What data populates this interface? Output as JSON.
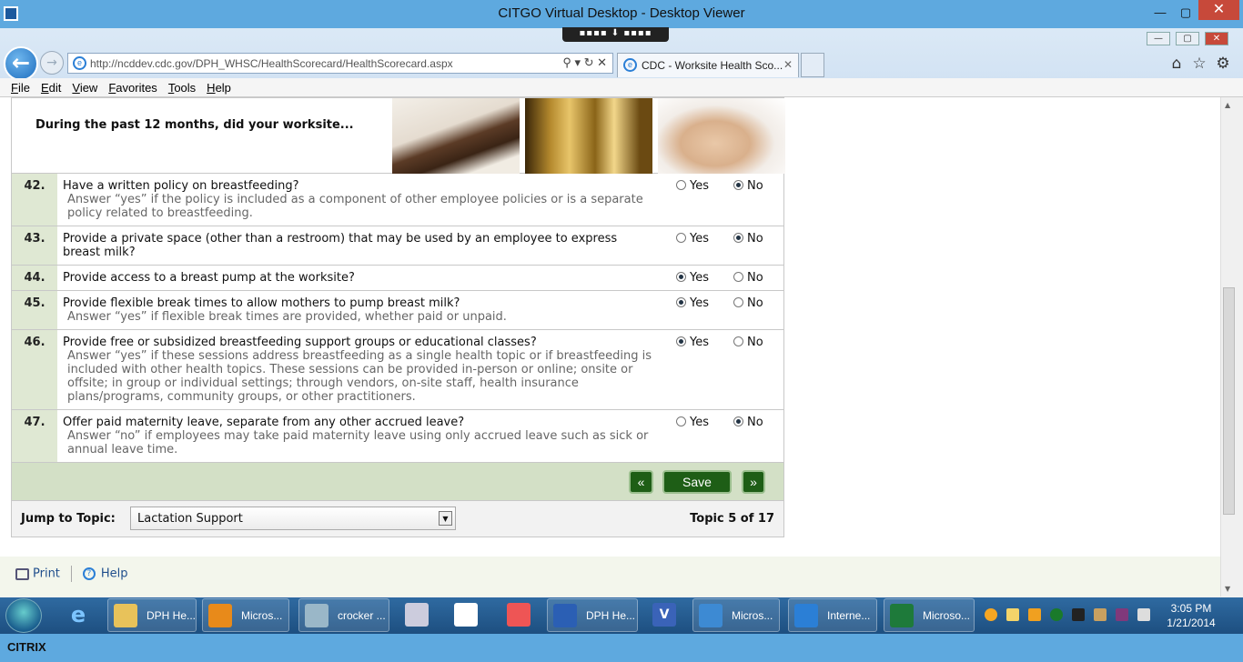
{
  "citrix": {
    "title": "CITGO Virtual Desktop - Desktop Viewer",
    "toolbar_label": "▪▪▪▪ ⬇ ▪▪▪▪",
    "minimize": "—",
    "restore": "▢",
    "close": "✕",
    "logo": "CITRIX"
  },
  "browser": {
    "back": "←",
    "forward": "→",
    "url": "http://ncddev.cdc.gov/DPH_WHSC/HealthScorecard/HealthScorecard.aspx",
    "address_tools": "⚲ ▾ ↻ ✕",
    "tab_title": "CDC - Worksite Health Sco...",
    "tab_close": "✕",
    "home": "⌂",
    "favorites": "☆",
    "settings": "⚙",
    "menu": [
      "File",
      "Edit",
      "View",
      "Favorites",
      "Tools",
      "Help"
    ]
  },
  "survey": {
    "header": "During the past 12 months, did your worksite...",
    "yes_label": "Yes",
    "no_label": "No",
    "questions": [
      {
        "num": "42.",
        "text": "Have a written policy on breastfeeding?",
        "hint": "Answer “yes” if the policy is included as a component of other employee policies or is a separate policy related to breastfeeding.",
        "answer": "No"
      },
      {
        "num": "43.",
        "text": "Provide a private space (other than a restroom) that may be used by an employee to express breast milk?",
        "hint": "",
        "answer": "No"
      },
      {
        "num": "44.",
        "text": "Provide access to a breast pump at the worksite?",
        "hint": "",
        "answer": "Yes"
      },
      {
        "num": "45.",
        "text": "Provide flexible break times to allow mothers to pump breast milk?",
        "hint": "Answer “yes” if flexible break times are provided, whether paid or unpaid.",
        "answer": "Yes"
      },
      {
        "num": "46.",
        "text": "Provide free or subsidized breastfeeding support groups or educational classes?",
        "hint": "Answer “yes” if these sessions address breastfeeding as a single health topic or if breastfeeding is included with other health topics. These sessions can be provided in-person or online; onsite or offsite; in group or individual settings; through vendors, on-site staff, health insurance plans/programs, community groups, or other practitioners.",
        "answer": "Yes"
      },
      {
        "num": "47.",
        "text": "Offer paid maternity leave, separate from any other accrued leave?",
        "hint": "Answer “no” if employees may take paid maternity leave using only accrued leave such as sick or annual leave time.",
        "answer": "No"
      }
    ],
    "prev_label": "«",
    "save_label": "Save",
    "next_label": "»",
    "jump_label": "Jump to Topic:",
    "jump_value": "Lactation Support",
    "topic_count": "Topic 5 of 17"
  },
  "footer": {
    "print": "Print",
    "help": "Help"
  },
  "taskbar": {
    "items": [
      {
        "label": "DPH He...",
        "icon": "folder-icon",
        "color": "#e8c25a"
      },
      {
        "label": "Micros...",
        "icon": "outlook-icon",
        "color": "#e88a1a"
      },
      {
        "label": "crocker ...",
        "icon": "notepad-icon",
        "color": "#9ab7c8"
      },
      {
        "label": "DPH He...",
        "icon": "word-icon",
        "color": "#2b5fb4"
      },
      {
        "label": "Micros...",
        "icon": "lync-icon",
        "color": "#3d8ad3"
      },
      {
        "label": "Interne...",
        "icon": "ie-icon",
        "color": "#2b7fd6"
      },
      {
        "label": "Microso...",
        "icon": "excel-icon",
        "color": "#1e7a3a"
      }
    ],
    "clock_time": "3:05 PM",
    "clock_date": "1/21/2014"
  },
  "colors": {
    "accent": "#5ea9df",
    "number_column": "#dfe8d3",
    "nav_row": "#d3e0c6",
    "button": "#1e5e16"
  }
}
